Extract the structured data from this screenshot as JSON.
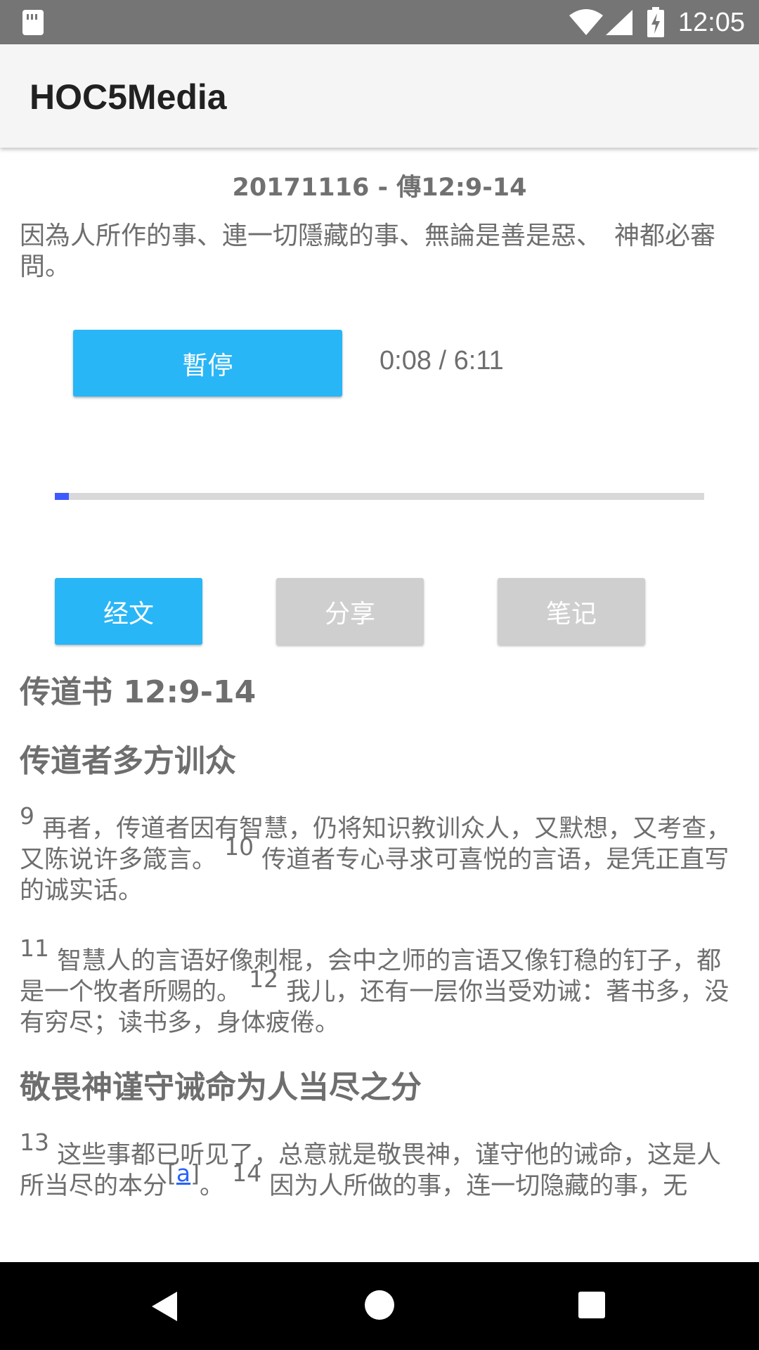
{
  "status_bar": {
    "time": "12:05",
    "icons": [
      "sd-card-icon",
      "wifi-icon",
      "signal-icon",
      "battery-charging-icon"
    ]
  },
  "app_bar": {
    "title": "HOC5Media"
  },
  "episode": {
    "title": "20171116 - 傳12:9-14",
    "summary": "因為人所作的事、連一切隱藏的事、無論是善是惡、　神都必審問。"
  },
  "player": {
    "pause_label": "暫停",
    "time_display": "0:08 / 6:11",
    "progress_fraction": 0.022
  },
  "tabs": [
    {
      "label": "经文",
      "active": true
    },
    {
      "label": "分享",
      "active": false
    },
    {
      "label": "笔记",
      "active": false
    }
  ],
  "scripture": {
    "reference": "传道书 12:9-14",
    "sections": [
      {
        "heading": "传道者多方训众",
        "paragraphs": [
          [
            {
              "num": "9",
              "text": "再者，传道者因有智慧，仍将知识教训众人，又默想，又考查，又陈说许多箴言。"
            },
            {
              "num": "10",
              "text": "传道者专心寻求可喜悦的言语，是凭正直写的诚实话。"
            }
          ],
          [
            {
              "num": "11",
              "text": "智慧人的言语好像刺棍，会中之师的言语又像钉稳的钉子，都是一个牧者所赐的。"
            },
            {
              "num": "12",
              "text": "我儿，还有一层你当受劝诫：著书多，没有穷尽；读书多，身体疲倦。"
            }
          ]
        ]
      },
      {
        "heading": "敬畏神谨守诫命为人当尽之分",
        "paragraphs": [
          [
            {
              "num": "13",
              "text": "这些事都已听见了，总意就是敬畏神，谨守他的诫命，这是人所当尽的本分",
              "footnote": "a",
              "after": "。"
            },
            {
              "num": "14",
              "text": "因为人所做的事，连一切隐藏的事，无"
            }
          ]
        ]
      }
    ]
  },
  "nav_bar": {
    "buttons": [
      "back-icon",
      "home-icon",
      "recents-icon"
    ]
  },
  "colors": {
    "accent": "#29b6f6",
    "progress": "#3d5afe",
    "inactive_button": "#cfcfcf",
    "status_bar": "#757575",
    "app_bar": "#f5f5f5",
    "link": "#2962ff"
  }
}
